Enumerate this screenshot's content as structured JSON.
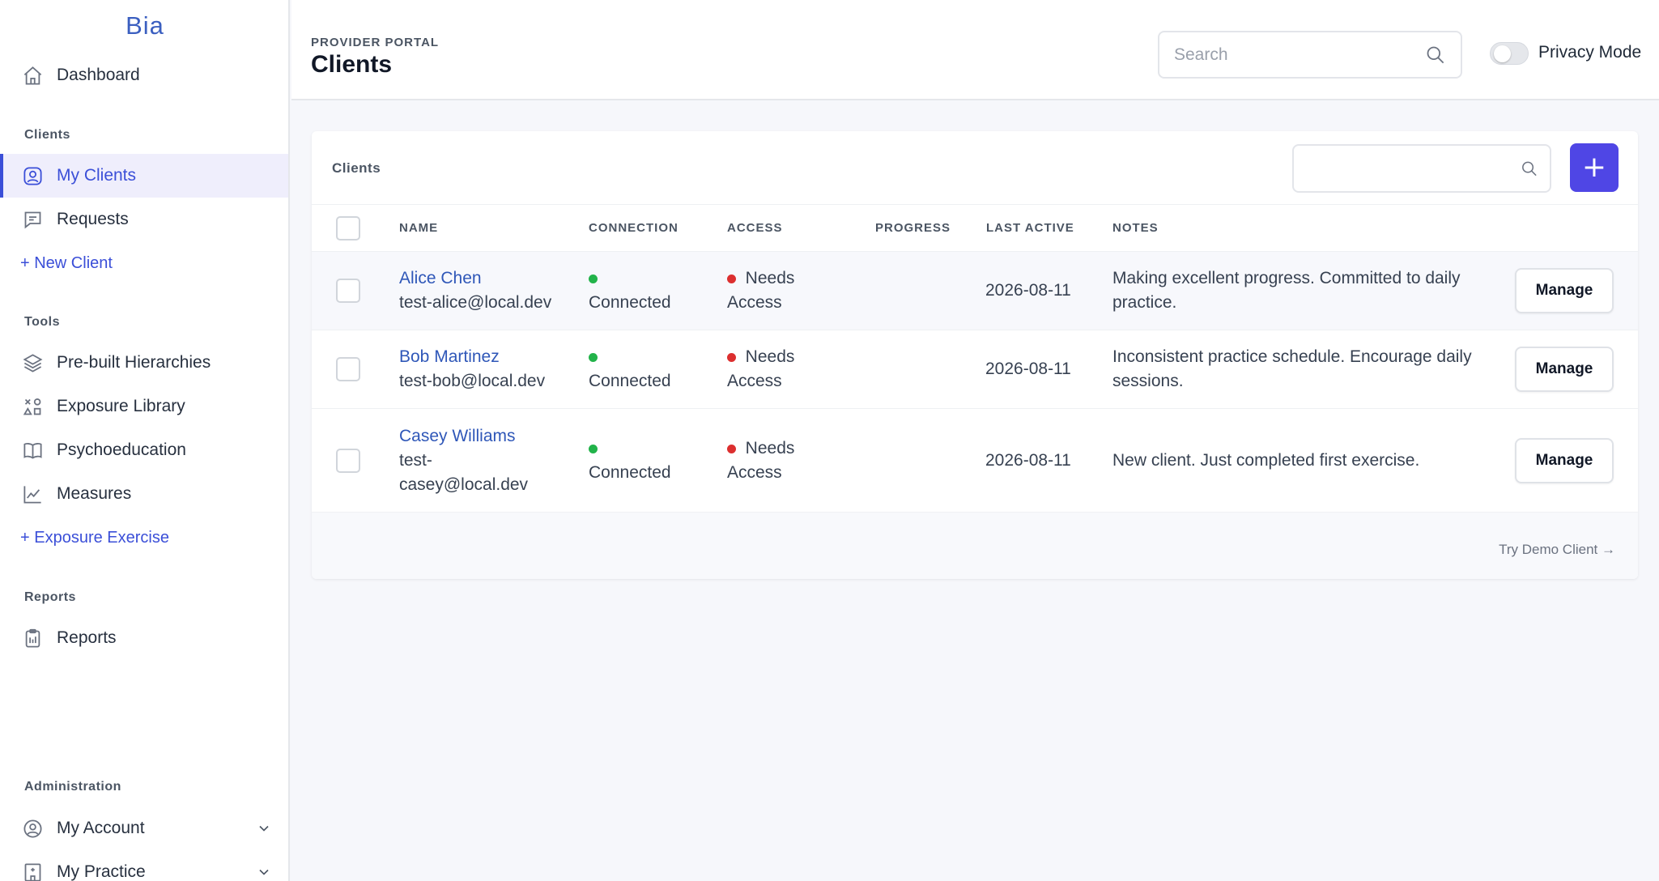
{
  "app": {
    "brand": "Bia"
  },
  "sidebar": {
    "dashboard": "Dashboard",
    "sections": {
      "clients": "Clients",
      "tools": "Tools",
      "reports": "Reports",
      "administration": "Administration"
    },
    "clients_items": {
      "my_clients": "My Clients",
      "requests": "Requests",
      "new_client": "+ New Client"
    },
    "tools_items": {
      "hierarchies": "Pre-built Hierarchies",
      "exposure_library": "Exposure Library",
      "psychoeducation": "Psychoeducation",
      "measures": "Measures",
      "exposure_exercise": "+ Exposure Exercise"
    },
    "reports_items": {
      "reports": "Reports"
    },
    "admin_items": {
      "my_account": "My Account",
      "my_practice": "My Practice"
    },
    "active_item": "My Clients",
    "accent_color": "#3b4fd8"
  },
  "header": {
    "portal_label": "PROVIDER PORTAL",
    "title": "Clients",
    "search_placeholder": "Search",
    "privacy_mode_label": "Privacy Mode",
    "privacy_mode_on": false
  },
  "card": {
    "title": "Clients",
    "search_value": "",
    "add_button_label": "+",
    "columns": {
      "name": "NAME",
      "connection": "CONNECTION",
      "access": "ACCESS",
      "progress": "PROGRESS",
      "last_active": "LAST ACTIVE",
      "notes": "NOTES"
    },
    "rows": [
      {
        "name": "Alice Chen",
        "email": "test-alice@local.dev",
        "connection": "Connected",
        "connection_status": "green",
        "access_line1": "Needs",
        "access_line2": "Access",
        "access_status": "red",
        "progress": "",
        "last_active": "2026-08-11",
        "notes_line1": "Making excellent progress. Committed to daily",
        "notes_line2": "practice.",
        "action": "Manage"
      },
      {
        "name": "Bob Martinez",
        "email": "test-bob@local.dev",
        "connection": "Connected",
        "connection_status": "green",
        "access_line1": "Needs",
        "access_line2": "Access",
        "access_status": "red",
        "progress": "",
        "last_active": "2026-08-11",
        "notes_line1": "Inconsistent practice schedule. Encourage daily",
        "notes_line2": "sessions.",
        "action": "Manage"
      },
      {
        "name": "Casey Williams",
        "email_line1": "test-",
        "email_line2": "casey@local.dev",
        "connection": "Connected",
        "connection_status": "green",
        "access_line1": "Needs",
        "access_line2": "Access",
        "access_status": "red",
        "progress": "",
        "last_active": "2026-08-11",
        "notes_line1": "New client. Just completed first exercise.",
        "action": "Manage"
      }
    ],
    "footer_link": "Try Demo Client →"
  }
}
